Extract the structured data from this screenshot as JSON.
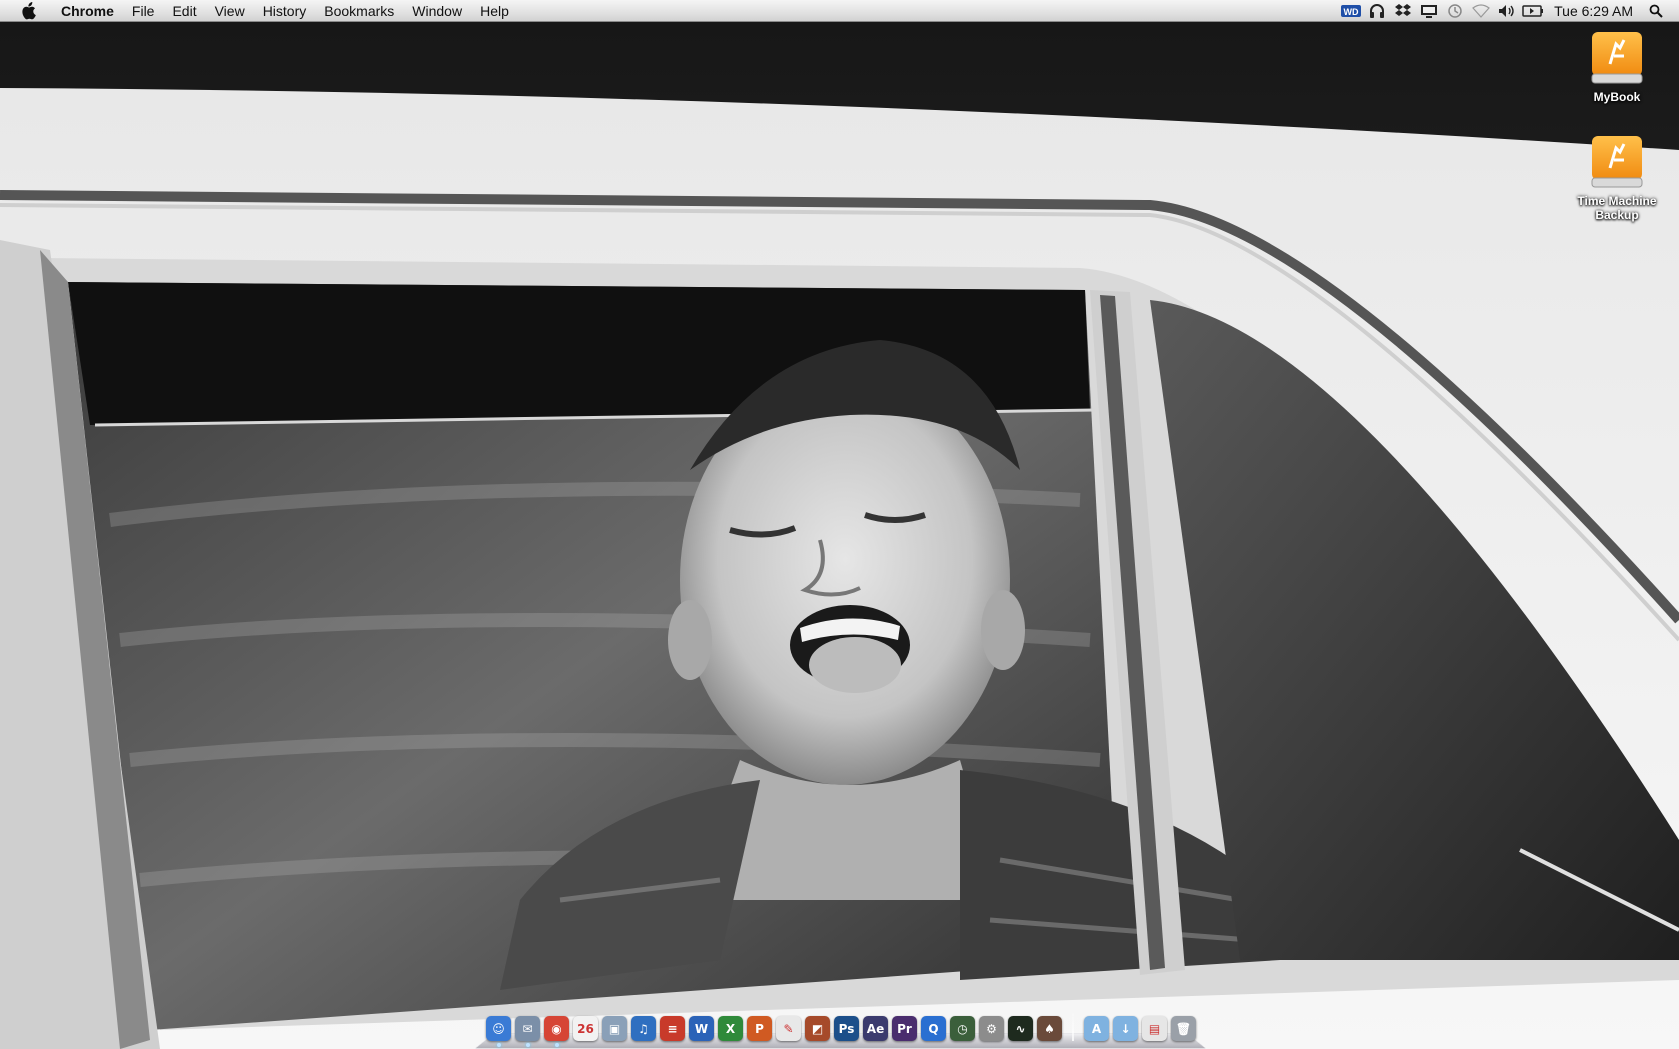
{
  "menubar": {
    "app_name": "Chrome",
    "menus": [
      "File",
      "Edit",
      "View",
      "History",
      "Bookmarks",
      "Window",
      "Help"
    ],
    "status_icons": [
      "wd-icon",
      "headphones-icon",
      "dropbox-icon",
      "display-icon",
      "time-machine-icon",
      "wifi-icon",
      "volume-icon",
      "battery-icon"
    ],
    "wd_text": "WD",
    "clock": "Tue 6:29 AM"
  },
  "desktop": {
    "icons": [
      {
        "label": "MyBook",
        "icon": "firewire-drive-icon"
      },
      {
        "label": "Time Machine Backup",
        "icon": "firewire-drive-icon"
      }
    ]
  },
  "dock": {
    "apps": [
      {
        "name": "finder-icon",
        "glyph": "☺",
        "color": "#3a7bd5",
        "running": true
      },
      {
        "name": "mail-icon",
        "glyph": "✉",
        "color": "#7b8fa8",
        "running": true
      },
      {
        "name": "chrome-icon",
        "glyph": "◉",
        "color": "#d64535",
        "running": true
      },
      {
        "name": "calendar-icon",
        "glyph": "26",
        "color": "#f2f2f2",
        "running": false
      },
      {
        "name": "preview-icon",
        "glyph": "▣",
        "color": "#8aa0b8",
        "running": false
      },
      {
        "name": "itunes-icon",
        "glyph": "♫",
        "color": "#2f6fc0",
        "running": false
      },
      {
        "name": "stack-icon",
        "glyph": "≡",
        "color": "#c83a2a",
        "running": false
      },
      {
        "name": "word-icon",
        "glyph": "W",
        "color": "#2b63b8",
        "running": false
      },
      {
        "name": "excel-icon",
        "glyph": "X",
        "color": "#2f8a3a",
        "running": false
      },
      {
        "name": "powerpoint-icon",
        "glyph": "P",
        "color": "#d05a22",
        "running": false
      },
      {
        "name": "textedit-icon",
        "glyph": "✎",
        "color": "#e8e8e8",
        "running": false
      },
      {
        "name": "photo-booth-icon",
        "glyph": "◩",
        "color": "#a64a2a",
        "running": false
      },
      {
        "name": "photoshop-icon",
        "glyph": "Ps",
        "color": "#1c4f8a",
        "running": false
      },
      {
        "name": "after-effects-icon",
        "glyph": "Ae",
        "color": "#3b3b6e",
        "running": false
      },
      {
        "name": "premiere-icon",
        "glyph": "Pr",
        "color": "#4a2d6e",
        "running": false
      },
      {
        "name": "quicktime-icon",
        "glyph": "Q",
        "color": "#2a6fd1",
        "running": false
      },
      {
        "name": "time-machine-icon",
        "glyph": "◷",
        "color": "#3b5f3b",
        "running": false
      },
      {
        "name": "system-preferences-icon",
        "glyph": "⚙",
        "color": "#8c8c8c",
        "running": false
      },
      {
        "name": "activity-monitor-icon",
        "glyph": "∿",
        "color": "#1e2a1e",
        "running": false
      },
      {
        "name": "utility-icon",
        "glyph": "♠",
        "color": "#6a4a3a",
        "running": false
      }
    ],
    "folders": [
      {
        "name": "applications-folder-icon",
        "glyph": "A",
        "color": "#7fb2e0"
      },
      {
        "name": "downloads-folder-icon",
        "glyph": "↓",
        "color": "#7fb2e0"
      },
      {
        "name": "documents-stack-icon",
        "glyph": "▤",
        "color": "#e6e6e6"
      },
      {
        "name": "trash-icon",
        "glyph": "🗑",
        "color": "#9aa0a8"
      }
    ]
  }
}
